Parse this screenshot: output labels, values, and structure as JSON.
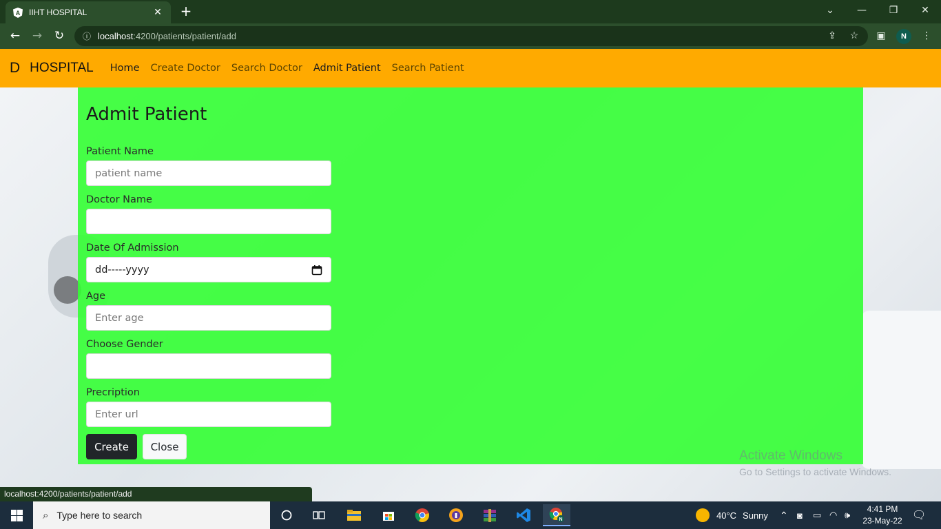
{
  "browser": {
    "tab_title": "IIHT HOSPITAL",
    "tab_favicon": "angular-icon",
    "url_host": "localhost",
    "url_path": ":4200/patients/patient/add",
    "profile_initial": "N",
    "status_url": "localhost:4200/patients/patient/add"
  },
  "navbar": {
    "brand_mark": "D",
    "brand_name": "HOSPITAL",
    "links": [
      {
        "label": "Home",
        "active": true
      },
      {
        "label": "Create Doctor",
        "active": false
      },
      {
        "label": "Search Doctor",
        "active": false
      },
      {
        "label": "Admit Patient",
        "active": true
      },
      {
        "label": "Search Patient",
        "active": false
      }
    ],
    "background": "#ffaa00"
  },
  "form": {
    "title": "Admit Patient",
    "panel_color": "#33ff33",
    "fields": [
      {
        "label": "Patient Name",
        "placeholder": "patient name",
        "value": ""
      },
      {
        "label": "Doctor Name",
        "placeholder": "",
        "value": ""
      },
      {
        "label": "Date Of Admission",
        "placeholder": "",
        "value": "dd-----yyyy"
      },
      {
        "label": "Age",
        "placeholder": "Enter age",
        "value": ""
      },
      {
        "label": "Choose Gender",
        "placeholder": "",
        "value": ""
      },
      {
        "label": "Precription",
        "placeholder": "Enter url",
        "value": ""
      }
    ],
    "create_label": "Create",
    "close_label": "Close"
  },
  "watermark": {
    "line1": "Activate Windows",
    "line2": "Go to Settings to activate Windows."
  },
  "taskbar": {
    "search_placeholder": "Type here to search",
    "weather_temp": "40°C",
    "weather_text": "Sunny",
    "time": "4:41 PM",
    "date": "23-May-22"
  }
}
